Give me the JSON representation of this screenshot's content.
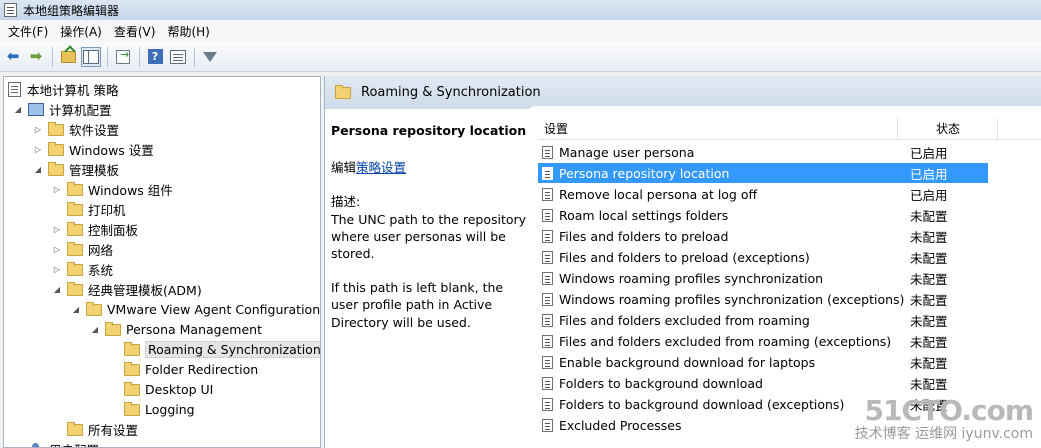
{
  "window": {
    "title": "本地组策略编辑器"
  },
  "menubar": {
    "items": [
      "文件(F)",
      "操作(A)",
      "查看(V)",
      "帮助(H)"
    ]
  },
  "toolbar": {
    "icons": [
      "back-arrow-icon",
      "forward-arrow-icon",
      "folder-up-icon",
      "show-hide-tree-icon",
      "export-list-icon",
      "help-icon",
      "properties-pane-icon",
      "filter-icon"
    ]
  },
  "tree": {
    "root": "本地计算机 策略",
    "items": [
      {
        "label": "计算机配置",
        "level": 1,
        "expander": "open",
        "icon": "computer-icon"
      },
      {
        "label": "软件设置",
        "level": 2,
        "expander": "closed",
        "icon": "folder-icon"
      },
      {
        "label": "Windows 设置",
        "level": 2,
        "expander": "closed",
        "icon": "folder-icon"
      },
      {
        "label": "管理模板",
        "level": 2,
        "expander": "open",
        "icon": "folder-icon"
      },
      {
        "label": "Windows 组件",
        "level": 3,
        "expander": "closed",
        "icon": "folder-icon"
      },
      {
        "label": "打印机",
        "level": 3,
        "expander": "none",
        "icon": "folder-icon"
      },
      {
        "label": "控制面板",
        "level": 3,
        "expander": "closed",
        "icon": "folder-icon"
      },
      {
        "label": "网络",
        "level": 3,
        "expander": "closed",
        "icon": "folder-icon"
      },
      {
        "label": "系统",
        "level": 3,
        "expander": "closed",
        "icon": "folder-icon"
      },
      {
        "label": "经典管理模板(ADM)",
        "level": 3,
        "expander": "open",
        "icon": "folder-icon"
      },
      {
        "label": "VMware View Agent Configuration",
        "level": 4,
        "expander": "open",
        "icon": "folder-icon"
      },
      {
        "label": "Persona Management",
        "level": 5,
        "expander": "open",
        "icon": "folder-icon"
      },
      {
        "label": "Roaming & Synchronization",
        "level": 6,
        "expander": "none",
        "icon": "folder-icon",
        "selected": true
      },
      {
        "label": "Folder Redirection",
        "level": 6,
        "expander": "none",
        "icon": "folder-icon"
      },
      {
        "label": "Desktop UI",
        "level": 6,
        "expander": "none",
        "icon": "folder-icon"
      },
      {
        "label": "Logging",
        "level": 6,
        "expander": "none",
        "icon": "folder-icon"
      },
      {
        "label": "所有设置",
        "level": 3,
        "expander": "none",
        "icon": "folder-icon"
      },
      {
        "label": "用户配置",
        "level": 1,
        "expander": "closed",
        "icon": "user-icon"
      }
    ]
  },
  "right": {
    "header": "Roaming & Synchronization",
    "description": {
      "title": "Persona repository location",
      "edit_prefix": "编辑",
      "edit_link": "策略设置",
      "desc_label": "描述:",
      "paragraph1": "The UNC path to the repository where user personas will be stored.",
      "paragraph2": "If this path is left blank, the user profile path in Active Directory will be used."
    },
    "columns": {
      "setting": "设置",
      "state": "状态"
    },
    "rows": [
      {
        "name": "Manage user persona",
        "state": "已启用"
      },
      {
        "name": "Persona repository location",
        "state": "已启用",
        "selected": true
      },
      {
        "name": "Remove local persona at log off",
        "state": "已启用"
      },
      {
        "name": "Roam local settings folders",
        "state": "未配置"
      },
      {
        "name": "Files and folders to preload",
        "state": "未配置"
      },
      {
        "name": "Files and folders to preload (exceptions)",
        "state": "未配置"
      },
      {
        "name": "Windows roaming profiles synchronization",
        "state": "未配置"
      },
      {
        "name": "Windows roaming profiles synchronization (exceptions)",
        "state": "未配置"
      },
      {
        "name": "Files and folders excluded from roaming",
        "state": "未配置"
      },
      {
        "name": "Files and folders excluded from roaming (exceptions)",
        "state": "未配置"
      },
      {
        "name": "Enable background download for laptops",
        "state": "未配置"
      },
      {
        "name": "Folders to background download",
        "state": "未配置"
      },
      {
        "name": "Folders to background download (exceptions)",
        "state": "未配置"
      },
      {
        "name": "Excluded Processes",
        "state": ""
      }
    ]
  },
  "watermark": {
    "main": "51CTO.com",
    "sub": "技术博客 运维网 iyunv.com"
  }
}
